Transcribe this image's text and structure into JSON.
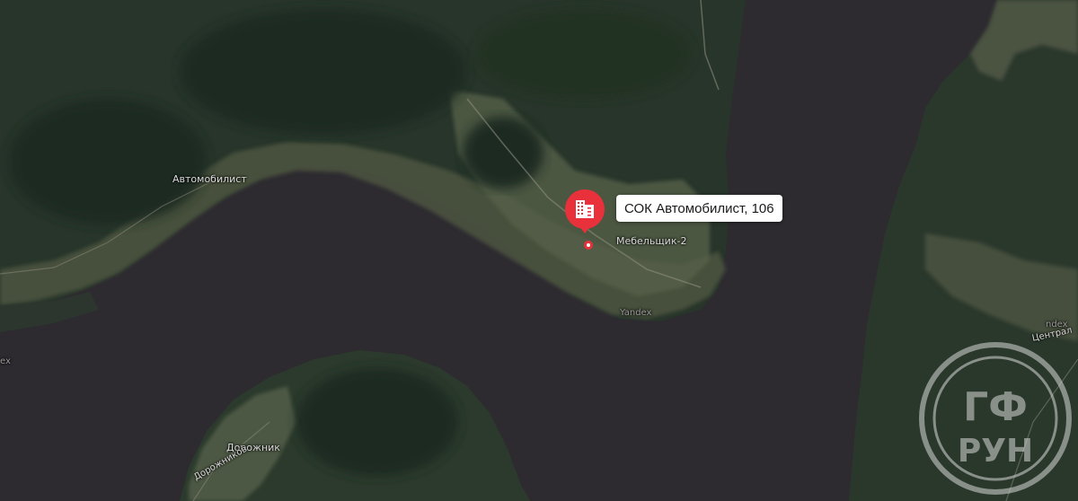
{
  "map": {
    "marker": {
      "label": "СОК Автомобилист, 106",
      "icon": "building-icon",
      "color": "#e8313a"
    },
    "places": {
      "avtomobilist": "Автомобилист",
      "mebelshchik": "Мебельщик-2",
      "dorozhnik": "Дорожник",
      "dorozhnikov": "Дорожников",
      "tsentral": "Централ",
      "yandex_a": "Yandex",
      "yandex_b": "ex",
      "yandex_c": "ndex"
    },
    "watermark": {
      "text_top": "ГФ",
      "text_bottom": "РУН"
    }
  }
}
